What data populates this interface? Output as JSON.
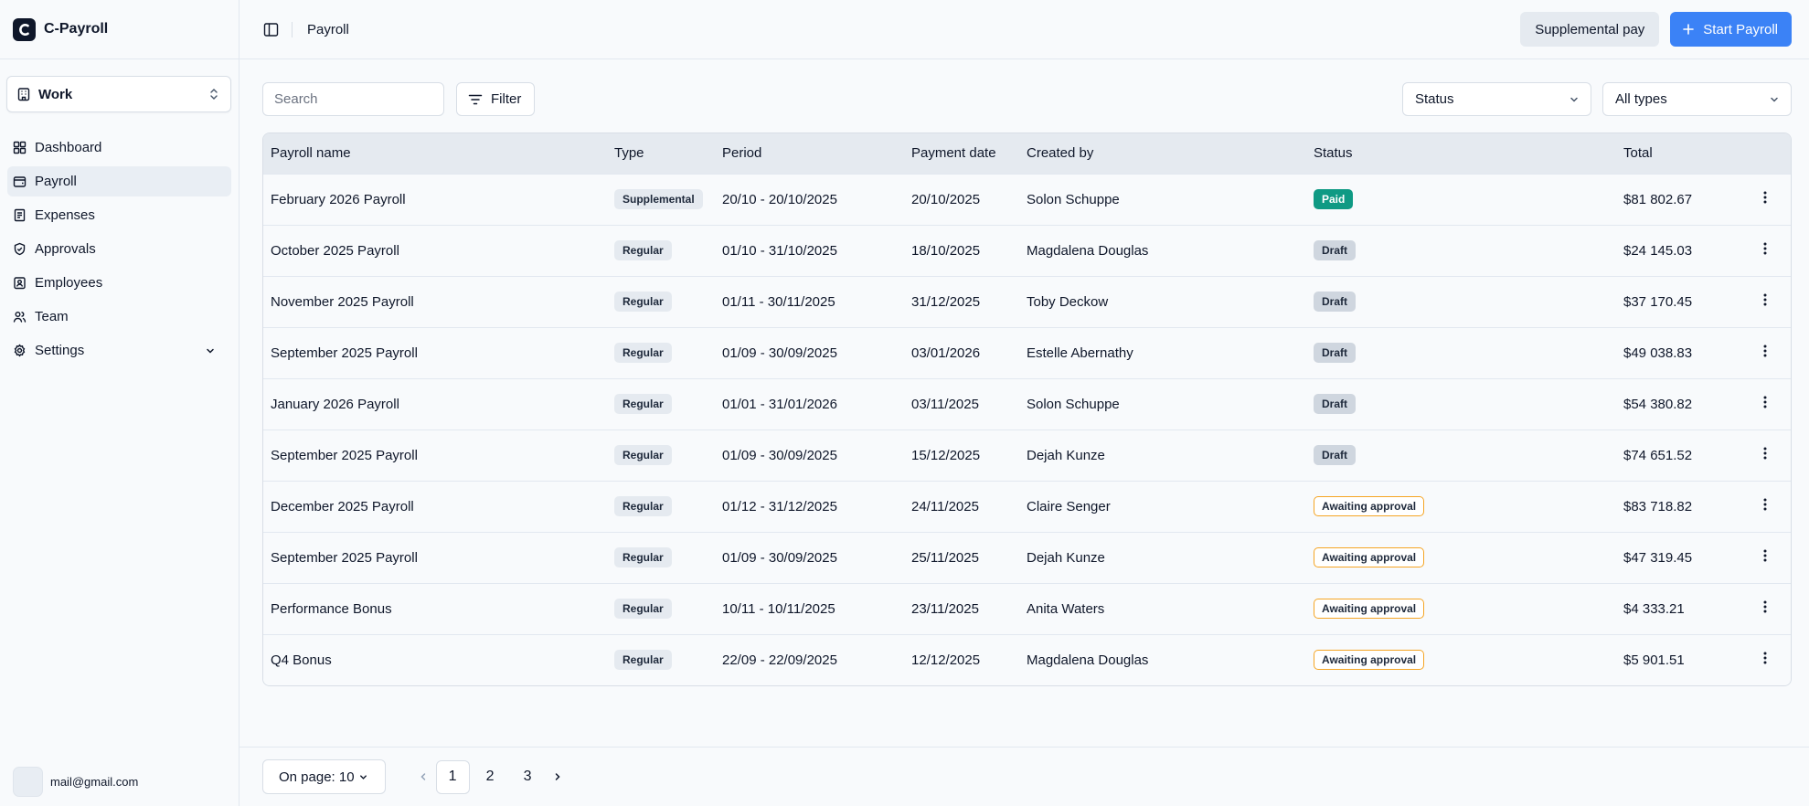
{
  "app": {
    "name": "C-Payroll"
  },
  "workspace": {
    "label": "Work"
  },
  "sidebar": {
    "items": [
      {
        "label": "Dashboard",
        "icon": "grid-icon",
        "active": false
      },
      {
        "label": "Payroll",
        "icon": "wallet-icon",
        "active": true
      },
      {
        "label": "Expenses",
        "icon": "receipt-icon",
        "active": false
      },
      {
        "label": "Approvals",
        "icon": "shield-check-icon",
        "active": false
      },
      {
        "label": "Employees",
        "icon": "contact-icon",
        "active": false
      },
      {
        "label": "Team",
        "icon": "users-icon",
        "active": false
      },
      {
        "label": "Settings",
        "icon": "gear-icon",
        "active": false
      }
    ]
  },
  "user": {
    "email": "mail@gmail.com"
  },
  "header": {
    "breadcrumb": "Payroll",
    "supplemental_label": "Supplemental pay",
    "start_label": "Start Payroll"
  },
  "toolbar": {
    "search_placeholder": "Search",
    "filter_label": "Filter",
    "status_select": "Status",
    "type_select": "All types"
  },
  "table": {
    "columns": [
      "Payroll name",
      "Type",
      "Period",
      "Payment date",
      "Created by",
      "Status",
      "Total"
    ],
    "rows": [
      {
        "name": "February 2026 Payroll",
        "type": "Supplemental",
        "period": "20/10 - 20/10/2025",
        "payment_date": "20/10/2025",
        "created_by": "Solon Schuppe",
        "status": "Paid",
        "total": "$81 802.67"
      },
      {
        "name": "October 2025 Payroll",
        "type": "Regular",
        "period": "01/10 - 31/10/2025",
        "payment_date": "18/10/2025",
        "created_by": "Magdalena Douglas",
        "status": "Draft",
        "total": "$24 145.03"
      },
      {
        "name": "November 2025 Payroll",
        "type": "Regular",
        "period": "01/11 - 30/11/2025",
        "payment_date": "31/12/2025",
        "created_by": "Toby Deckow",
        "status": "Draft",
        "total": "$37 170.45"
      },
      {
        "name": "September 2025 Payroll",
        "type": "Regular",
        "period": "01/09 - 30/09/2025",
        "payment_date": "03/01/2026",
        "created_by": "Estelle Abernathy",
        "status": "Draft",
        "total": "$49 038.83"
      },
      {
        "name": "January 2026 Payroll",
        "type": "Regular",
        "period": "01/01 - 31/01/2026",
        "payment_date": "03/11/2025",
        "created_by": "Solon Schuppe",
        "status": "Draft",
        "total": "$54 380.82"
      },
      {
        "name": "September 2025 Payroll",
        "type": "Regular",
        "period": "01/09 - 30/09/2025",
        "payment_date": "15/12/2025",
        "created_by": "Dejah Kunze",
        "status": "Draft",
        "total": "$74 651.52"
      },
      {
        "name": "December 2025 Payroll",
        "type": "Regular",
        "period": "01/12 - 31/12/2025",
        "payment_date": "24/11/2025",
        "created_by": "Claire Senger",
        "status": "Awaiting approval",
        "total": "$83 718.82"
      },
      {
        "name": "September 2025 Payroll",
        "type": "Regular",
        "period": "01/09 - 30/09/2025",
        "payment_date": "25/11/2025",
        "created_by": "Dejah Kunze",
        "status": "Awaiting approval",
        "total": "$47 319.45"
      },
      {
        "name": "Performance Bonus",
        "type": "Regular",
        "period": "10/11 - 10/11/2025",
        "payment_date": "23/11/2025",
        "created_by": "Anita Waters",
        "status": "Awaiting approval",
        "total": "$4 333.21"
      },
      {
        "name": "Q4 Bonus",
        "type": "Regular",
        "period": "22/09 - 22/09/2025",
        "payment_date": "12/12/2025",
        "created_by": "Magdalena Douglas",
        "status": "Awaiting approval",
        "total": "$5 901.51"
      }
    ]
  },
  "pagination": {
    "per_page_label": "On page: 10",
    "pages": [
      "1",
      "2",
      "3"
    ],
    "current": "1"
  },
  "colors": {
    "primary": "#3b82f6",
    "paid": "#0f9a84",
    "draft": "#cfd6df",
    "awaiting_border": "#f5a524"
  }
}
